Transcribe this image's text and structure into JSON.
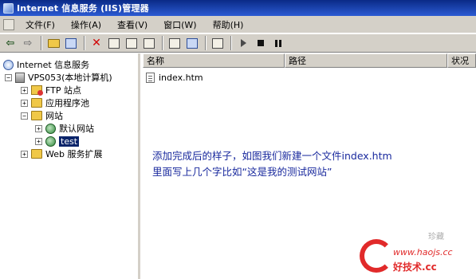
{
  "window": {
    "title": "Internet 信息服务 (IIS)管理器"
  },
  "menu": {
    "items": [
      {
        "label": "文件(F)"
      },
      {
        "label": "操作(A)"
      },
      {
        "label": "查看(V)"
      },
      {
        "label": "窗口(W)"
      },
      {
        "label": "帮助(H)"
      }
    ]
  },
  "toolbar": {
    "icons": [
      "back-arrow-icon",
      "forward-arrow-icon",
      "up-folder-icon",
      "show-tree-icon",
      "delete-icon",
      "properties-icon",
      "refresh-icon",
      "export-icon",
      "help-icon",
      "console-icon",
      "computer-icon",
      "start-icon",
      "stop-icon",
      "pause-icon"
    ]
  },
  "tree": {
    "root": "Internet 信息服务",
    "server": "VPS053(本地计算机)",
    "ftp": "FTP 站点",
    "apppool": "应用程序池",
    "websites": "网站",
    "default_site": "默认网站",
    "test_site": "test",
    "web_ext": "Web 服务扩展"
  },
  "list": {
    "columns": {
      "name": "名称",
      "path": "路径",
      "status": "状况"
    },
    "rows": [
      {
        "name": "index.htm"
      }
    ]
  },
  "annotation": {
    "line1": "添加完成后的样子，如图我们新建一个文件index.htm",
    "line2": "里面写上几个字比如“这是我的测试网站”"
  },
  "watermark": {
    "small": "珍藏",
    "url": "www.haojs.cc",
    "name": "好技术.cc"
  },
  "colors": {
    "titlebar": "#0a2a86",
    "chrome": "#d4d0c8",
    "annotation": "#1a2a9e",
    "watermark": "#e12a2a",
    "selection": "#0a246a"
  }
}
